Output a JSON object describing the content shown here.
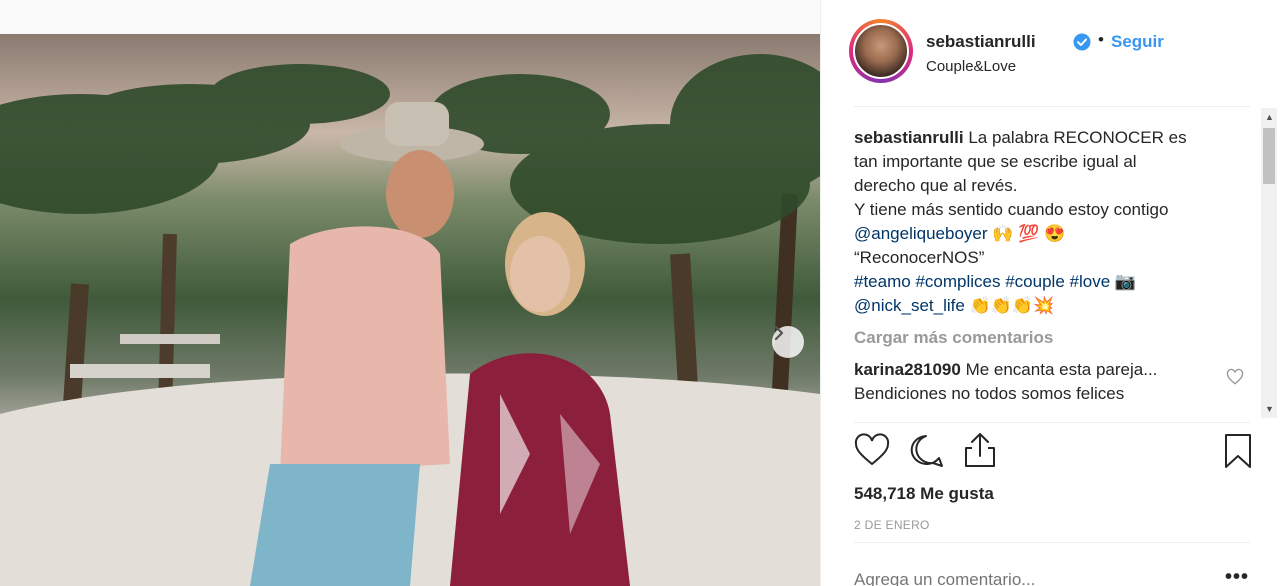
{
  "post": {
    "username": "sebastianrulli",
    "separator": "•",
    "follow_label": "Seguir",
    "location": "Couple&Love"
  },
  "caption": {
    "username": "sebastianrulli",
    "line1": "La palabra RECONOCER es",
    "line2": "tan importante que se escribe igual al",
    "line3": "derecho que al revés.",
    "line4": "Y tiene más sentido cuando estoy contigo",
    "mention": "@angeliqueboyer",
    "mention_emoji": "🙌 💯 😍",
    "quote": "“ReconocerNOS”",
    "hashtags": [
      "#teamo",
      "#complices",
      "#couple",
      "#love"
    ],
    "hashtag_emoji": "📷",
    "mention2": "@nick_set_life",
    "mention2_emoji": "👏👏👏💥"
  },
  "load_more": "Cargar más comentarios",
  "comment": {
    "username": "karina281090",
    "text": "Me encanta esta pareja...",
    "text2": "Bendiciones no todos somos felices"
  },
  "likes_text": "548,718 Me gusta",
  "date_text": "2 DE ENERO",
  "add_comment_placeholder": "Agrega un comentario...",
  "more_options": "•••",
  "colors": {
    "accent": "#3897f0",
    "link": "#003569",
    "muted": "#999999",
    "text": "#262626"
  },
  "carousel": {
    "count": 3,
    "active_index": 0
  },
  "icons": [
    "verified-badge-icon",
    "chevron-right-icon",
    "heart-icon",
    "comment-icon",
    "share-icon",
    "bookmark-icon"
  ]
}
